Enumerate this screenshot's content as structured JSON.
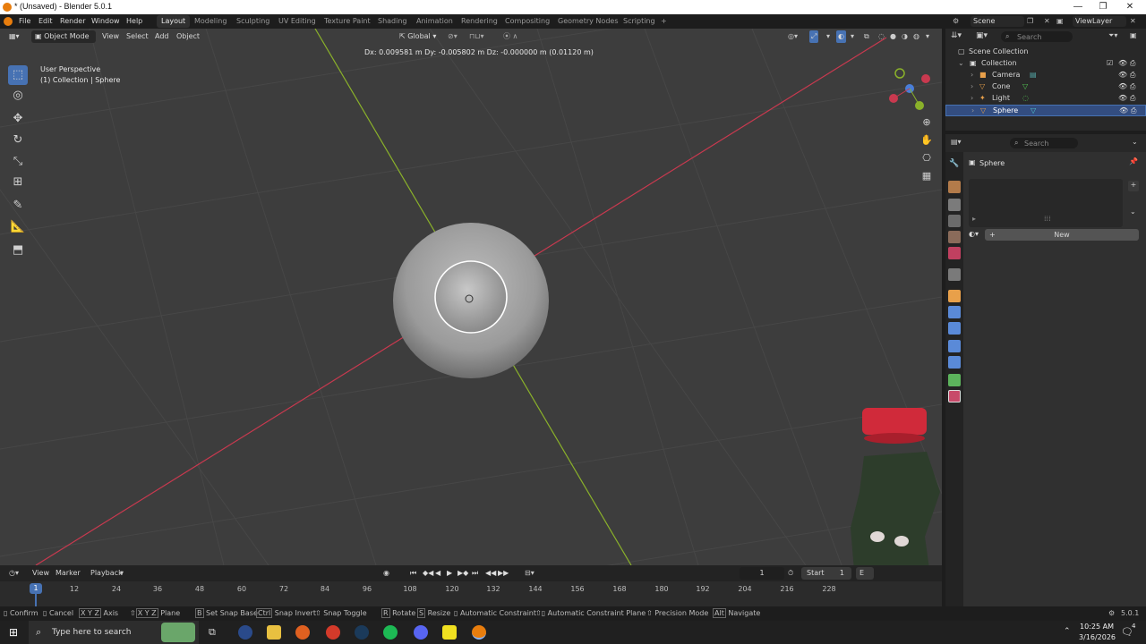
{
  "window": {
    "title": "* (Unsaved) - Blender 5.0.1",
    "controls": [
      "—",
      "❐",
      "✕"
    ]
  },
  "menubar": {
    "menus": [
      "File",
      "Edit",
      "Render",
      "Window",
      "Help"
    ],
    "workspaces": [
      "Layout",
      "Modeling",
      "Sculpting",
      "UV Editing",
      "Texture Paint",
      "Shading",
      "Animation",
      "Rendering",
      "Compositing",
      "Geometry Nodes",
      "Scripting"
    ],
    "add_tab": "+",
    "scene": "Scene",
    "view_layer": "ViewLayer"
  },
  "viewport": {
    "mode": "Object Mode",
    "menus": [
      "View",
      "Select",
      "Add",
      "Object"
    ],
    "orientation": "Global",
    "perspective_label": "User Perspective",
    "collection_label": "(1) Collection | Sphere",
    "delta_readout": "Dx: 0.009581 m   Dy: -0.005802 m   Dz: -0.000000 m (0.01120 m)",
    "gizmo_axes": [
      "X",
      "Y",
      "Z"
    ]
  },
  "outliner": {
    "search_placeholder": "Search",
    "root": "Scene Collection",
    "collection": "Collection",
    "items": [
      {
        "name": "Camera",
        "color": "#e8a04a"
      },
      {
        "name": "Cone",
        "color": "#e8a04a"
      },
      {
        "name": "Light",
        "color": "#e8a04a"
      },
      {
        "name": "Sphere",
        "color": "#e8a04a",
        "selected": true
      }
    ]
  },
  "properties": {
    "search_placeholder": "Search",
    "object_name": "Sphere",
    "new_button": "New",
    "add_slot": "+",
    "expand": "▸"
  },
  "timeline": {
    "menus": [
      "View",
      "Marker",
      "Playback"
    ],
    "current_frame": "1",
    "start_label": "Start",
    "start_value": "1",
    "end_label": "E",
    "ticks": [
      "1",
      "12",
      "24",
      "36",
      "48",
      "60",
      "72",
      "84",
      "96",
      "108",
      "120",
      "132",
      "144",
      "156",
      "168",
      "180",
      "192",
      "204",
      "216",
      "228"
    ]
  },
  "statusbar": {
    "hints": [
      {
        "key": "",
        "text": "Confirm"
      },
      {
        "key": "",
        "text": "Cancel"
      },
      {
        "key": "X Y Z",
        "text": "Axis"
      },
      {
        "key": "X Y Z",
        "text": "Plane"
      },
      {
        "key": "B",
        "text": "Set Snap Base"
      },
      {
        "key": "Ctrl",
        "text": "Snap Invert"
      },
      {
        "key": "",
        "text": "Snap Toggle"
      },
      {
        "key": "R",
        "text": "Rotate"
      },
      {
        "key": "S",
        "text": "Resize"
      },
      {
        "key": "",
        "text": "Automatic Constraint"
      },
      {
        "key": "",
        "text": "Automatic Constraint Plane"
      },
      {
        "key": "",
        "text": "Precision Mode"
      },
      {
        "key": "Alt",
        "text": "Navigate"
      }
    ],
    "version": "5.0.1"
  },
  "taskbar": {
    "search_placeholder": "Type here to search",
    "time": "10:25 AM",
    "date": "3/16/2026",
    "notification_count": "4"
  },
  "colors": {
    "accent": "#4772b3",
    "x_axis": "#c9394f",
    "y_axis": "#8ab12a",
    "viewport_bg": "#3d3d3d",
    "panel_bg": "#303030"
  }
}
